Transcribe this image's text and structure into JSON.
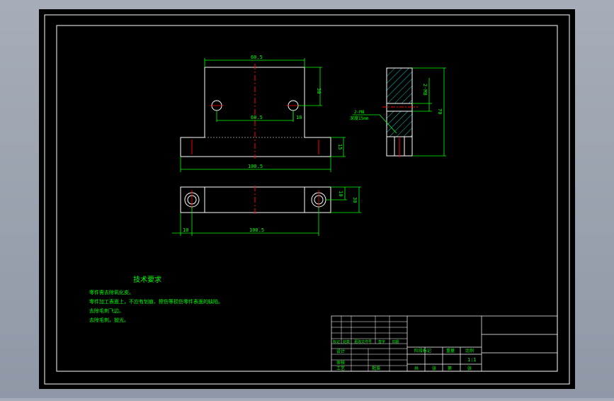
{
  "colors": {
    "background": "#000000",
    "frame": "#ffffff",
    "outline": "#ffffff",
    "dimension": "#00ff00",
    "centerline": "#ff0000",
    "hatch": "#00ffff",
    "text": "#00ff00"
  },
  "front_view": {
    "dims": {
      "top_width": "60.5",
      "hole_spacing": "60.5",
      "right_height": "30",
      "hole_offset": "10",
      "base_height": "15",
      "overall_width": "100.5"
    }
  },
  "top_view": {
    "dims": {
      "left_offset": "10",
      "length": "100.5",
      "inner_height": "10",
      "outer_height": "30"
    }
  },
  "side_view": {
    "dims": {
      "top_dim": "2-M8",
      "overall": "70"
    },
    "leader_text": [
      "2-M8",
      "深度15mm"
    ]
  },
  "technical_requirements": {
    "title": "技术要求",
    "lines": [
      "零件需去除氧化皮。",
      "零件加工表面上，不应有划痕、擦伤等损伤零件表面的缺陷。",
      "去除毛刺飞边。",
      "去除毛刺，抛光。"
    ]
  },
  "title_block": {
    "labels": [
      "标记",
      "处数",
      "更改文件号",
      "签字",
      "日期",
      "设计",
      "阶段标记",
      "重量",
      "比例",
      "审核",
      "工艺",
      "批准",
      "共",
      "张",
      "第",
      "张"
    ],
    "scale": "1:1"
  }
}
